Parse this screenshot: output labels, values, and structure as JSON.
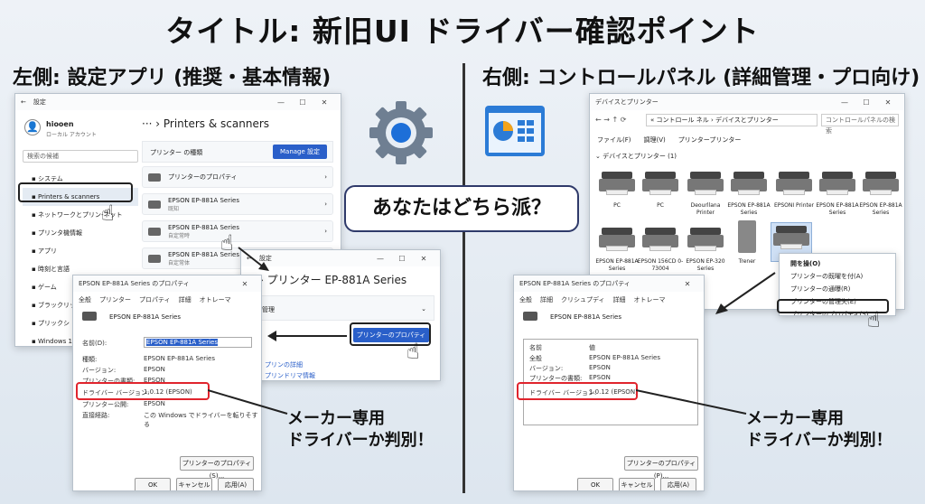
{
  "title": "タイトル: 新旧UI ドライバー確認ポイント",
  "left_header": "左側: 設定アプリ (推奨・基本情報)",
  "right_header": "右側: コントロールパネル (詳細管理・プロ向け)",
  "question": "あなたはどちら派？",
  "callout_line1": "メーカー専用",
  "callout_line2": "ドライバーか判別！",
  "settings": {
    "window_title": "設定",
    "user_name": "hiooen",
    "user_sub": "ローカル アカウント",
    "search": "検索の候補",
    "breadcrumb": "Printers & scanners",
    "printer_type_label": "プリンター の種類",
    "manage_btn": "Manage 設定",
    "sidebar": [
      "システム",
      "Printers & scanners",
      "ネットワークとプリン-ネット",
      "プリンタ機情報",
      "アプリ",
      "時刻と言語",
      "ゲーム",
      "ブラックリット",
      "プリックシ",
      "Windows 11"
    ],
    "printers": [
      {
        "name": "プリンターのプロパティ",
        "sub": ""
      },
      {
        "name": "EPSON EP-881A Series",
        "sub": "既知"
      },
      {
        "name": "EPSON EP-881A Series",
        "sub": "自定常時"
      },
      {
        "name": "EPSON EP-881A Series",
        "sub": "自定常体"
      }
    ]
  },
  "sub_settings": {
    "window_title": "設定",
    "title": "プリンター EP-881A Series",
    "manage": "管理",
    "props_btn": "プリンターのプロパティ",
    "link1": "プリンの詳細",
    "link2": "プリンドリマ情報"
  },
  "left_props": {
    "title": "EPSON EP-881A Series のプロパティ",
    "tabs": [
      "全般",
      "プリンター",
      "プロパティ",
      "詳細",
      "オトレーマ"
    ],
    "printer_name": "EPSON EP-881A Series",
    "fields": [
      {
        "k": "名前(D):",
        "v": "EPSON EP-881A Series"
      },
      {
        "k": "種類:",
        "v": "EPSON EP-881A Series"
      },
      {
        "k": "バージョン:",
        "v": "EPSON"
      },
      {
        "k": "プリンターの書類:",
        "v": "EPSON"
      },
      {
        "k": "ドライバー バージョン:",
        "v": "1.0.12 (EPSON)"
      },
      {
        "k": "プリンター公開:",
        "v": "EPSON"
      },
      {
        "k": "直接経路:",
        "v": "この Windows でドライバーを転りそする"
      }
    ],
    "props_btn": "プリンターのプロパティ(S)...",
    "ok": "OK",
    "cancel": "キャンセル",
    "apply": "応用(A)"
  },
  "devices": {
    "window_title": "デバイスとプリンター",
    "address": "« コントロール ネル › デバイスとプリンター",
    "search": "コントロールパネルの検索",
    "menu": [
      "ファイル(F)",
      "調理(V)",
      "プリンタープリンター"
    ],
    "group": "デバイスとプリンター (1)",
    "items": [
      "PC",
      "PC",
      "Deourllana Printer",
      "EPSON EP-881A Series",
      "EPSONI Printer",
      "EPSON EP-881A Series",
      "EPSON EP-881A Series",
      "EPSON EP-881A Series",
      "EPSON 156CD 0-73004",
      "EPSON EP-320 Series",
      "Trener",
      "EP"
    ],
    "context": [
      "開を操(O)",
      "プリンターの既曜を付(A)",
      "プリンターの通曝(R)",
      "プリンターの管理失(E)",
      "プリンターのプロパティ(S)"
    ]
  },
  "right_props": {
    "title": "EPSON EP-881A Series のプロパティ",
    "tabs": [
      "全般",
      "詳細",
      "クリシュプディ",
      "詳細",
      "オトレーマ"
    ],
    "printer_name": "EPSON EP-881A Series",
    "col1": "名前",
    "col2": "値",
    "fields": [
      {
        "k": "全般",
        "v": "EPSON EP-881A Series"
      },
      {
        "k": "バージョン:",
        "v": "EPSON"
      },
      {
        "k": "プリンターの書類:",
        "v": "EPSON"
      },
      {
        "k": "ドライバー バージョン:",
        "v": "1.0.12 (EPSON)"
      }
    ],
    "props_btn": "プリンターのプロパティ(P)...",
    "ok": "OK",
    "cancel": "キャンセル",
    "apply": "応用(A)"
  }
}
